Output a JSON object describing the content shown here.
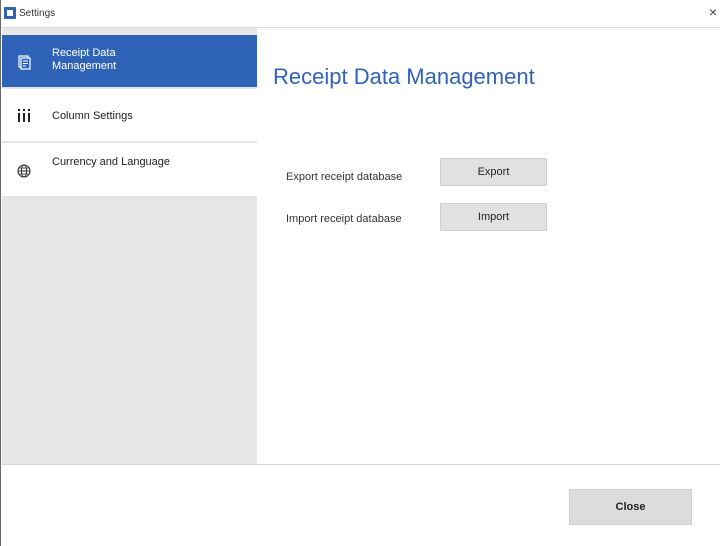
{
  "window": {
    "title": "Settings",
    "close_glyph": "×"
  },
  "colors": {
    "accent": "#2f63b8",
    "sidebar_bg": "#e6e6e6",
    "button_bg": "#e1e1e1"
  },
  "sidebar": {
    "items": [
      {
        "label": "Receipt Data Management",
        "icon": "receipt-icon",
        "active": true
      },
      {
        "label": "Column Settings",
        "icon": "columns-icon",
        "active": false
      },
      {
        "label": "Currency and Language",
        "icon": "globe-icon",
        "active": false
      }
    ]
  },
  "main": {
    "title": "Receipt Data Management",
    "rows": [
      {
        "label": "Export receipt database",
        "button": "Export"
      },
      {
        "label": "Import receipt database",
        "button": "Import"
      }
    ]
  },
  "footer": {
    "close_label": "Close"
  }
}
